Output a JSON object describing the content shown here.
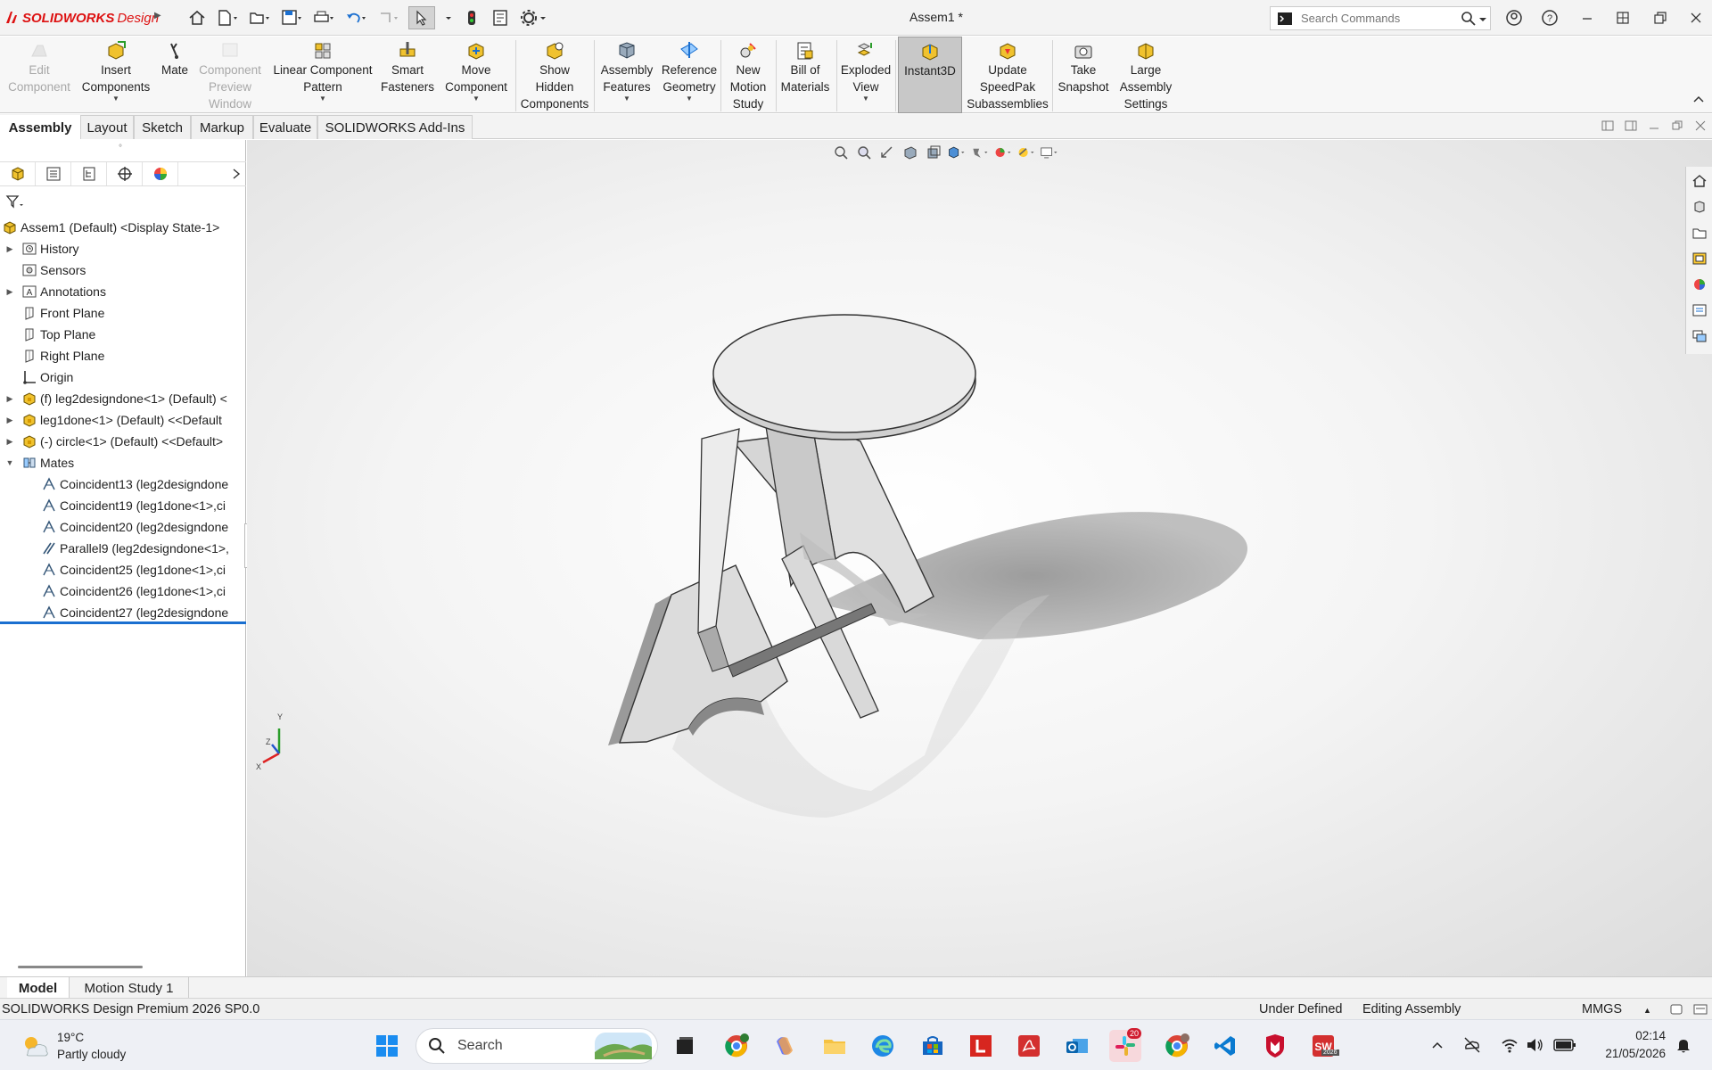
{
  "app": {
    "brand_sw": "SOLIDWORKS",
    "brand_design": "Design",
    "title": "Assem1 *"
  },
  "search": {
    "placeholder": "Search Commands"
  },
  "ribbon": [
    {
      "label1": "Edit",
      "label2": "Component",
      "label3": "",
      "state": "disabled",
      "icon": "edit-component-icon",
      "caret": false
    },
    {
      "label1": "Insert",
      "label2": "Components",
      "label3": "",
      "state": "normal",
      "icon": "insert-components-icon",
      "caret": true
    },
    {
      "label1": "Mate",
      "label2": "",
      "label3": "",
      "state": "normal",
      "icon": "mate-icon",
      "caret": false
    },
    {
      "label1": "Component",
      "label2": "Preview",
      "label3": "Window",
      "state": "disabled",
      "icon": "component-preview-icon",
      "caret": false
    },
    {
      "label1": "Linear Component",
      "label2": "Pattern",
      "label3": "",
      "state": "normal",
      "icon": "linear-pattern-icon",
      "caret": true
    },
    {
      "label1": "Smart",
      "label2": "Fasteners",
      "label3": "",
      "state": "normal",
      "icon": "smart-fasteners-icon",
      "caret": false
    },
    {
      "label1": "Move",
      "label2": "Component",
      "label3": "",
      "state": "normal",
      "icon": "move-component-icon",
      "caret": true
    },
    {
      "label1": "Show",
      "label2": "Hidden",
      "label3": "Components",
      "state": "normal",
      "icon": "show-hidden-icon",
      "caret": false
    },
    {
      "label1": "Assembly",
      "label2": "Features",
      "label3": "",
      "state": "normal",
      "icon": "assembly-features-icon",
      "caret": true
    },
    {
      "label1": "Reference",
      "label2": "Geometry",
      "label3": "",
      "state": "normal",
      "icon": "reference-geometry-icon",
      "caret": true
    },
    {
      "label1": "New",
      "label2": "Motion",
      "label3": "Study",
      "state": "normal",
      "icon": "new-motion-study-icon",
      "caret": false
    },
    {
      "label1": "Bill of",
      "label2": "Materials",
      "label3": "",
      "state": "normal",
      "icon": "bill-of-materials-icon",
      "caret": false
    },
    {
      "label1": "Exploded",
      "label2": "View",
      "label3": "",
      "state": "normal",
      "icon": "exploded-view-icon",
      "caret": true
    },
    {
      "label1": "Instant3D",
      "label2": "",
      "label3": "",
      "state": "active",
      "icon": "instant3d-icon",
      "caret": false
    },
    {
      "label1": "Update",
      "label2": "SpeedPak",
      "label3": "Subassemblies",
      "state": "normal",
      "icon": "speedpak-icon",
      "caret": false
    },
    {
      "label1": "Take",
      "label2": "Snapshot",
      "label3": "",
      "state": "normal",
      "icon": "snapshot-icon",
      "caret": false
    },
    {
      "label1": "Large",
      "label2": "Assembly",
      "label3": "Settings",
      "state": "normal",
      "icon": "large-assembly-icon",
      "caret": false
    }
  ],
  "tabs": [
    "Assembly",
    "Layout",
    "Sketch",
    "Markup",
    "Evaluate",
    "SOLIDWORKS Add-Ins"
  ],
  "tree": [
    {
      "label": "Assem1 (Default) <Display State-1>",
      "icon": "assembly-icon",
      "indent": 0,
      "expander": ""
    },
    {
      "label": "History",
      "icon": "history-icon",
      "indent": 1,
      "expander": "▶"
    },
    {
      "label": "Sensors",
      "icon": "sensors-icon",
      "indent": 1,
      "expander": ""
    },
    {
      "label": "Annotations",
      "icon": "annotations-icon",
      "indent": 1,
      "expander": "▶"
    },
    {
      "label": "Front Plane",
      "icon": "plane-icon",
      "indent": 1,
      "expander": ""
    },
    {
      "label": "Top Plane",
      "icon": "plane-icon",
      "indent": 1,
      "expander": ""
    },
    {
      "label": "Right Plane",
      "icon": "plane-icon",
      "indent": 1,
      "expander": ""
    },
    {
      "label": "Origin",
      "icon": "origin-icon",
      "indent": 1,
      "expander": ""
    },
    {
      "label": "(f) leg2designdone<1> (Default) <",
      "icon": "part-icon",
      "indent": 1,
      "expander": "▶"
    },
    {
      "label": "leg1done<1> (Default) <<Default",
      "icon": "part-icon",
      "indent": 1,
      "expander": "▶"
    },
    {
      "label": "(-) circle<1> (Default) <<Default>",
      "icon": "part-icon",
      "indent": 1,
      "expander": "▶"
    },
    {
      "label": "Mates",
      "icon": "mates-icon",
      "indent": 1,
      "expander": "▼"
    },
    {
      "label": "Coincident13 (leg2designdone",
      "icon": "coincident-icon",
      "indent": 2,
      "expander": ""
    },
    {
      "label": "Coincident19 (leg1done<1>,ci",
      "icon": "coincident-icon",
      "indent": 2,
      "expander": ""
    },
    {
      "label": "Coincident20 (leg2designdone",
      "icon": "coincident-icon",
      "indent": 2,
      "expander": ""
    },
    {
      "label": "Parallel9 (leg2designdone<1>,",
      "icon": "parallel-icon",
      "indent": 2,
      "expander": ""
    },
    {
      "label": "Coincident25 (leg1done<1>,ci",
      "icon": "coincident-icon",
      "indent": 2,
      "expander": ""
    },
    {
      "label": "Coincident26 (leg1done<1>,ci",
      "icon": "coincident-icon",
      "indent": 2,
      "expander": ""
    },
    {
      "label": "Coincident27 (leg2designdone",
      "icon": "coincident-icon",
      "indent": 2,
      "expander": ""
    }
  ],
  "triad": {
    "x": "X",
    "y": "Y",
    "z": "Z"
  },
  "bottom_tabs": [
    "Model",
    "Motion Study 1"
  ],
  "status": {
    "product": "SOLIDWORKS Design Premium 2026 SP0.0",
    "state": "Under Defined",
    "mode": "Editing Assembly",
    "units": "MMGS"
  },
  "taskbar": {
    "weather_temp": "19°C",
    "weather_desc": "Partly cloudy",
    "search_label": "Search",
    "time": "02:14",
    "date": "21/05/2026",
    "slack_badge": "20",
    "sw_badge": "2026"
  },
  "colors": {
    "accent": "#1a6fd0",
    "brand_red": "#d11111",
    "active_button": "#c8c8c8"
  }
}
